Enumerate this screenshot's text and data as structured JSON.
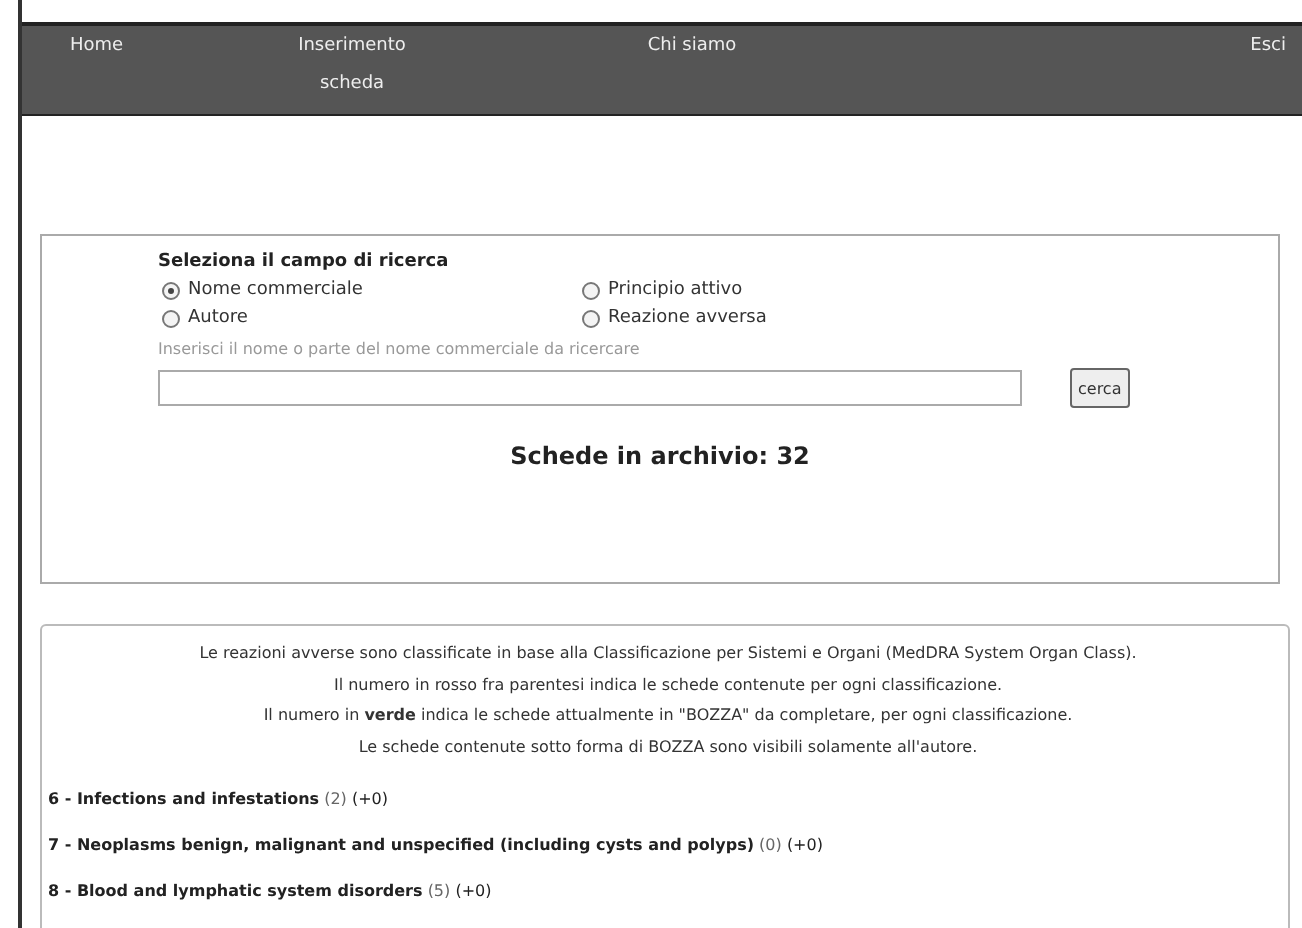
{
  "nav": [
    {
      "label": "Home"
    },
    {
      "label": "Inserimento scheda"
    },
    {
      "label": "Chi siamo"
    },
    {
      "label": "Esci"
    }
  ],
  "search": {
    "heading": "Seleziona il campo di ricerca",
    "options": [
      {
        "label": "Nome commerciale",
        "selected": true
      },
      {
        "label": "Principio attivo",
        "selected": false
      },
      {
        "label": "Autore",
        "selected": false
      },
      {
        "label": "Reazione avversa",
        "selected": false
      }
    ],
    "hint": "Inserisci il nome o parte del nome commerciale da ricercare",
    "button": "cerca",
    "archive": "Schede in archivio: 32"
  },
  "info": [
    "Le reazioni avverse sono classificate in base alla Classificazione per Sistemi e Organi (MedDRA System Organ Class).",
    "Il numero in rosso fra parentesi indica le schede contenute per ogni classificazione.",
    "Il numero in **verde** indica le schede attualmente in \"BOZZA\" da completare, per ogni classificazione.",
    "Le schede contenute sotto forma di BOZZA sono visibili solamente all'autore."
  ],
  "categories": [
    {
      "title": "6 - Infections and infestations",
      "count": "(2)",
      "draft": "(+0)"
    },
    {
      "title": "7 - Neoplasms benign, malignant and unspecified (including cysts and polyps)",
      "count": "(0)",
      "draft": "(+0)"
    },
    {
      "title": "8 - Blood and lymphatic system disorders",
      "count": "(5)",
      "draft": "(+0)"
    }
  ]
}
